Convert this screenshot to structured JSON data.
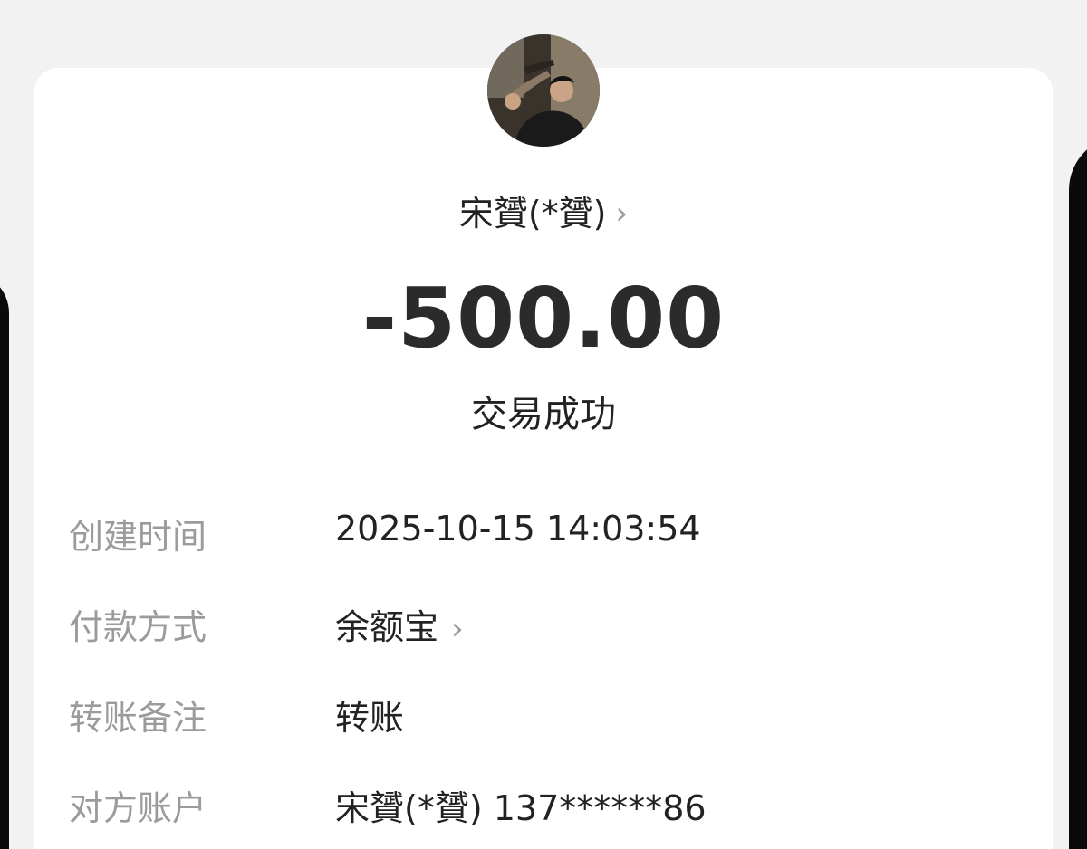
{
  "payee": {
    "name": "宋贇(*贇)",
    "chevron": "›"
  },
  "amount": "-500.00",
  "status": "交易成功",
  "details": [
    {
      "label": "创建时间",
      "value": "2025-10-15 14:03:54"
    },
    {
      "label": "付款方式",
      "value": "余额宝",
      "chevron": "›"
    },
    {
      "label": "转账备注",
      "value": "转账"
    },
    {
      "label": "对方账户",
      "value": "宋贇(*贇) 137******86"
    }
  ],
  "icons": {
    "avatar": "user-photo-avatar",
    "payee_chevron": "chevron-right-icon",
    "payment_chevron": "chevron-right-icon"
  },
  "colors": {
    "background": "#f2f2f2",
    "card": "#ffffff",
    "primary_text": "#222222",
    "label_text": "#9b9b9b",
    "chevron": "#9a9a9a"
  }
}
